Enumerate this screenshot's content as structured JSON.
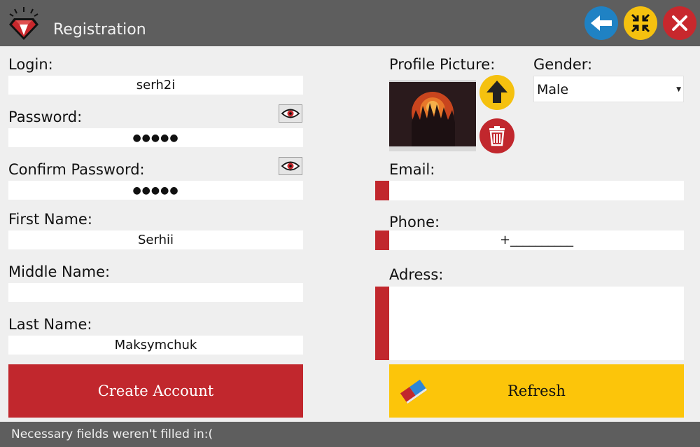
{
  "window": {
    "title": "Registration",
    "icons": {
      "logo": "ruby-gem-icon",
      "back": "arrow-left-icon",
      "minimize": "collapse-icon",
      "close": "close-icon"
    },
    "colors": {
      "titlebar": "#5e5e5e",
      "back": "#1f82c4",
      "minimize": "#f5c10f",
      "close": "#c8282d"
    }
  },
  "form": {
    "login": {
      "label": "Login:",
      "value": "serh2i"
    },
    "password": {
      "label": "Password:",
      "value": "●●●●●"
    },
    "confirm_password": {
      "label": "Confirm Password:",
      "value": "●●●●●"
    },
    "first_name": {
      "label": "First Name:",
      "value": "Serhii"
    },
    "middle_name": {
      "label": "Middle Name:",
      "value": ""
    },
    "last_name": {
      "label": "Last Name:",
      "value": "Maksymchuk"
    },
    "profile_picture": {
      "label": "Profile Picture:"
    },
    "gender": {
      "label": "Gender:",
      "value": "Male"
    },
    "email": {
      "label": "Email:",
      "value": ""
    },
    "phone": {
      "label": "Phone:",
      "value": "+__________"
    },
    "address": {
      "label": "Adress:",
      "value": ""
    }
  },
  "buttons": {
    "create": "Create Account",
    "refresh": "Refresh"
  },
  "status": {
    "text": "Necessary fields weren't filled in:("
  },
  "accent_colors": {
    "required_marker": "#c1272d",
    "create_button": "#c1272d",
    "refresh_button": "#fcc50a"
  }
}
